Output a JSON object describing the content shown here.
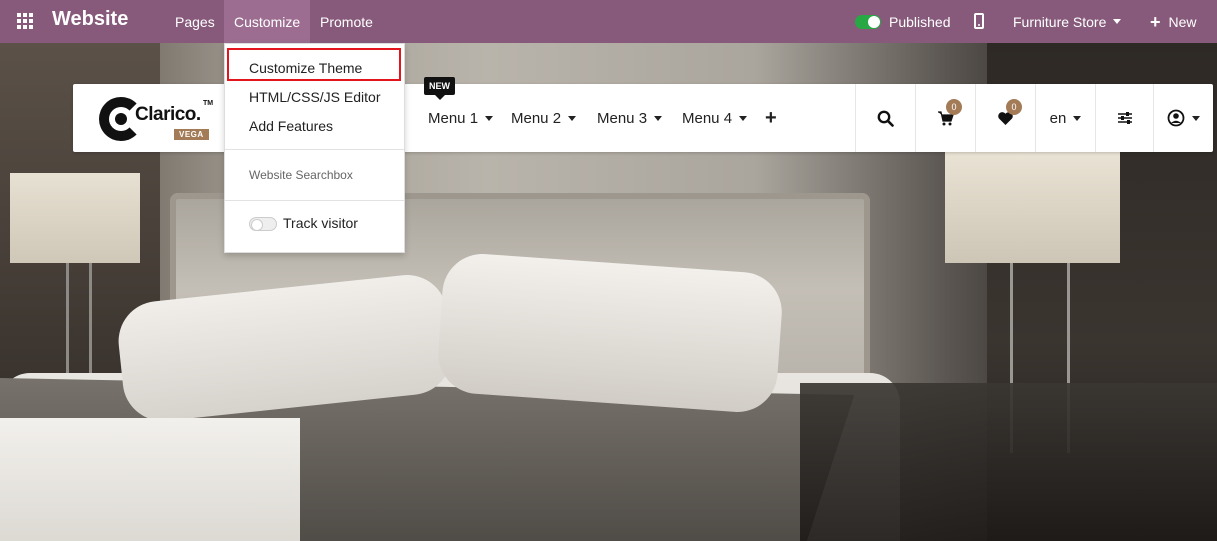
{
  "topbar": {
    "brand": "Website",
    "menus": [
      "Pages",
      "Customize",
      "Promote"
    ],
    "published_label": "Published",
    "website_name": "Furniture Store",
    "new_label": "New",
    "bg_color": "#875a7b"
  },
  "customize_dropdown": {
    "items": [
      "Customize Theme",
      "HTML/CSS/JS Editor",
      "Add Features"
    ],
    "section_label": "Website Searchbox",
    "track_visitor_label": "Track visitor",
    "highlight_color": "#e3141b"
  },
  "site_header": {
    "logo_text": "Clarico.",
    "logo_tm": "TM",
    "logo_sub": "VEGA",
    "new_badge": "NEW",
    "menus": [
      "Menu 1",
      "Menu 2",
      "Menu 3",
      "Menu 4"
    ],
    "add_menu_symbol": "+",
    "cart_count": "0",
    "wishlist_count": "0",
    "language": "en",
    "accent_color": "#a37b57"
  },
  "icons": [
    "apps-grid-icon",
    "mobile-preview-icon",
    "search-icon",
    "cart-icon",
    "heart-icon",
    "filter-sliders-icon",
    "user-icon"
  ]
}
